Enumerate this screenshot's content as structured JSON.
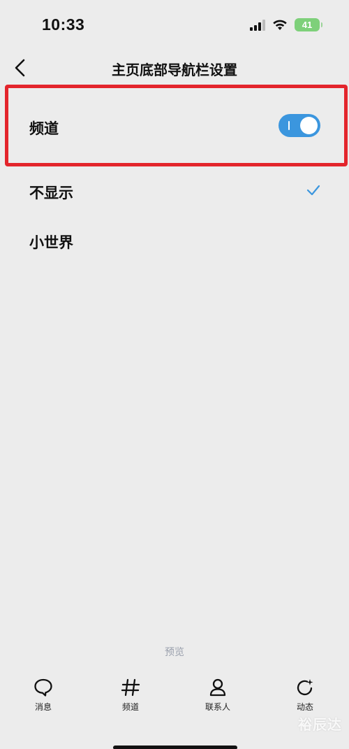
{
  "status_bar": {
    "time": "10:33",
    "battery": "41",
    "icons": [
      "signal-icon",
      "wifi-icon",
      "battery-icon"
    ]
  },
  "nav": {
    "title": "主页底部导航栏设置",
    "back_icon": "chevron-left-icon"
  },
  "settings": {
    "channel_toggle": {
      "label": "频道",
      "enabled": true
    },
    "options": [
      {
        "label": "不显示",
        "selected": true
      },
      {
        "label": "小世界",
        "selected": false
      }
    ]
  },
  "preview": {
    "label": "预览",
    "tabs": [
      {
        "label": "消息",
        "icon": "chat-bubble-icon"
      },
      {
        "label": "频道",
        "icon": "hashtag-icon"
      },
      {
        "label": "联系人",
        "icon": "person-icon"
      },
      {
        "label": "动态",
        "icon": "refresh-star-icon"
      }
    ]
  },
  "watermark": "裕辰达",
  "colors": {
    "background": "#ececec",
    "accent": "#3b96de",
    "highlight": "#e3252c",
    "battery": "#7ed07a"
  }
}
